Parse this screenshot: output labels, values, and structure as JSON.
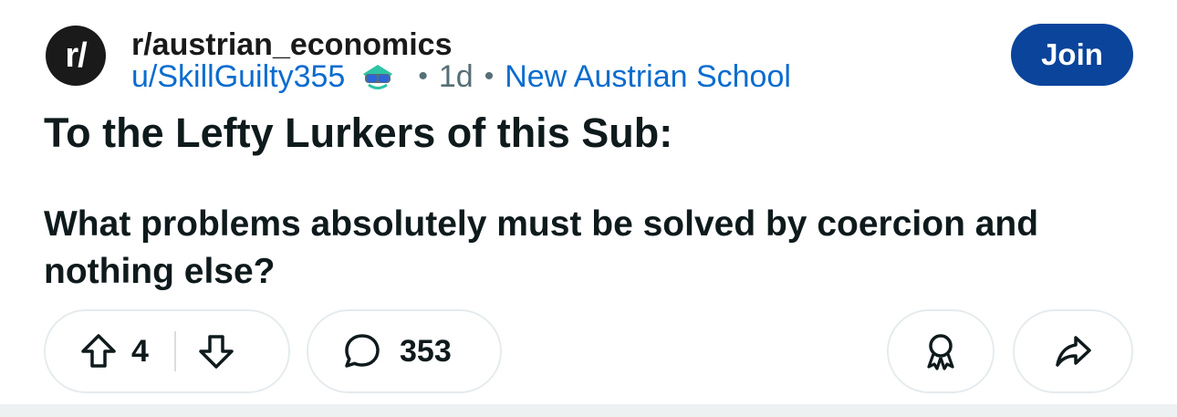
{
  "post": {
    "subreddit": "r/austrian_economics",
    "subreddit_icon_text": "r/",
    "username": "u/SkillGuilty355",
    "separator": "•",
    "time_ago": "1d",
    "flair": "New Austrian School",
    "join_label": "Join",
    "title": "To the Lefty Lurkers of this Sub:",
    "body": "What problems absolutely must be solved by coercion and nothing else?"
  },
  "actions": {
    "vote_count": "4",
    "comment_count": "353",
    "upvote_icon": "arrow-up-icon",
    "downvote_icon": "arrow-down-icon",
    "comment_icon": "speech-bubble-icon",
    "award_icon": "award-ribbon-icon",
    "share_icon": "share-arrow-icon"
  },
  "colors": {
    "join_button": "#0a449b",
    "link_blue": "#0a6ccf",
    "meta_gray": "#576f76",
    "border": "#e5ebee"
  }
}
